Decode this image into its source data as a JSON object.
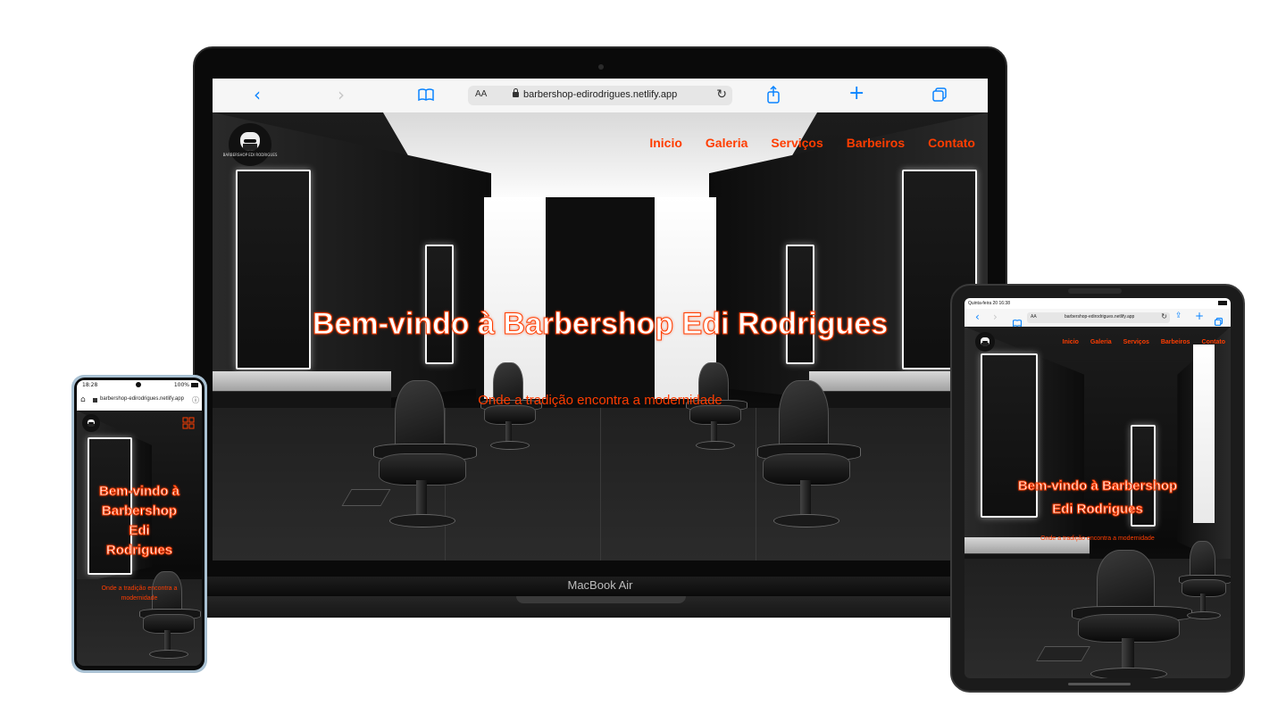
{
  "brand": {
    "accent": "#ff3d00",
    "logo_text": "BARBERSHOP EDI RODRIGUES"
  },
  "nav": {
    "items": [
      "Inicio",
      "Galeria",
      "Serviços",
      "Barbeiros",
      "Contato"
    ]
  },
  "hero": {
    "title": "Bem-vindo à Barbershop Edi Rodrigues",
    "title_lines": [
      "Bem-vindo à",
      "Barbershop",
      "Edi",
      "Rodrigues"
    ],
    "tablet_title_lines": [
      "Bem-vindo à Barbershop",
      "Edi Rodrigues"
    ],
    "subtitle": "Onde a tradição encontra a modernidade",
    "subtitle_lines": [
      "Onde a tradição encontra a",
      "modernidade"
    ]
  },
  "laptop": {
    "url": "barbershop-edirodrigues.netlify.app",
    "reader_label": "AA",
    "model_label": "MacBook Air",
    "icons": [
      "back-icon",
      "forward-icon",
      "bookmarks-icon",
      "reload-icon",
      "share-icon",
      "new-tab-icon",
      "tabs-icon"
    ]
  },
  "phone": {
    "time": "18:28",
    "battery": "100%",
    "url": "barbershop-edirodrigues.netlify.app"
  },
  "tablet": {
    "datetime": "Quinta-feira 20 16:38",
    "reader_label": "AA",
    "url": "barbershop-edirodrigues.netlify.app"
  }
}
